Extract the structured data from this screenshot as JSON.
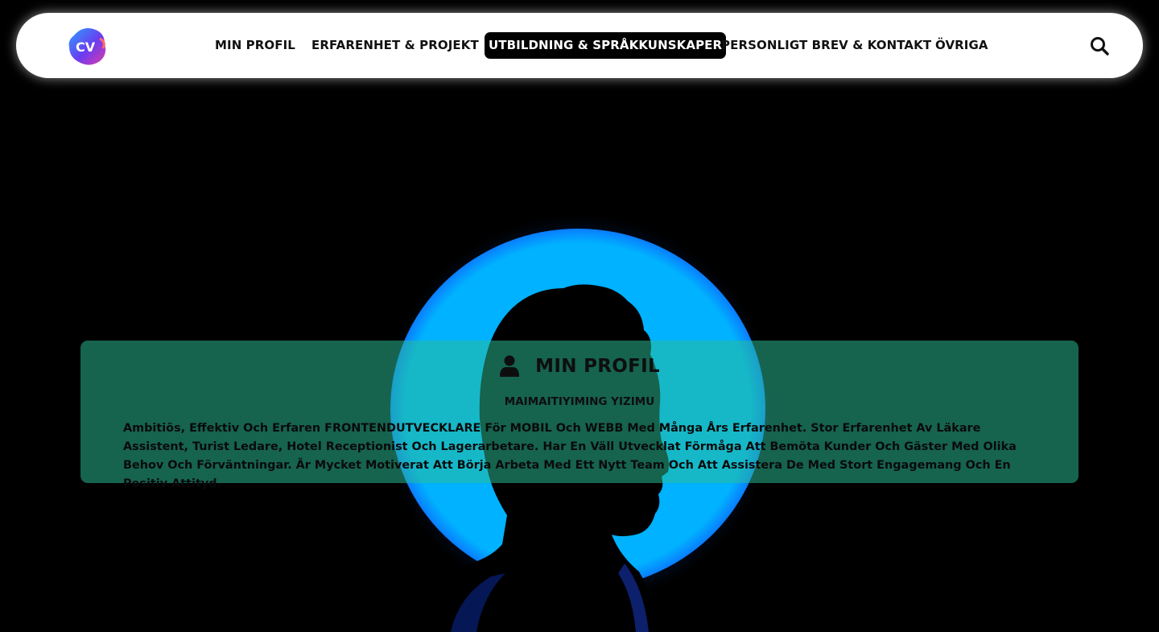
{
  "nav": {
    "logo_text": "CV",
    "items": [
      {
        "label": "Min Profil"
      },
      {
        "label": "Erfarenhet & Projekt"
      },
      {
        "label": "Utbildning & Språkkunskaper"
      },
      {
        "label": "Personligt Brev & Kontakt"
      },
      {
        "label": "Övriga"
      }
    ],
    "active_index": 2,
    "search_icon": "search-icon"
  },
  "hero": {
    "image": "silhouette-portrait-with-blue-halo",
    "halo_color": "#00b2ff"
  },
  "profile": {
    "icon": "user-icon",
    "title": "MIN PROFIL",
    "name": "Maimaitiyiming Yizimu",
    "description": "Ambitiös, Effektiv Och Erfaren FRONTENDUTVECKLARE För MOBIL Och WEBB Med Många Års Erfarenhet. Stor Erfarenhet Av Läkare Assistent, Turist Ledare, Hotel Receptionist Och Lagerarbetare. Har En Väll Utvecklat Förmåga Att Bemöta Kunder Och Gäster Med Olika Behov Och Förväntningar. Är Mycket Motiverat Att Börja Arbeta Med Ett Nytt Team Och Att Assistera De Med Stort Engagemang Och En Positiv Attityd."
  },
  "colors": {
    "background": "#000000",
    "navbar": "#ffffff",
    "active_tab": "#000000",
    "card": "#2abe96",
    "halo": "#00b2ff"
  }
}
